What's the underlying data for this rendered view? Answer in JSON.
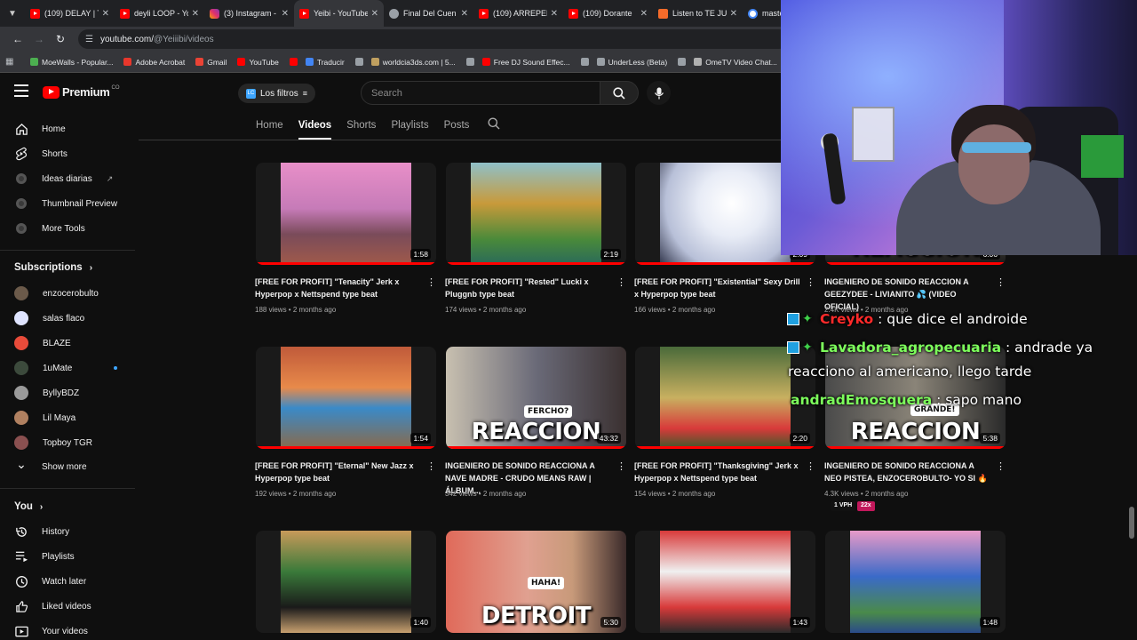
{
  "browser": {
    "tabs": [
      {
        "title": "(109) DELAY | T",
        "icon": "youtube-icon",
        "active": false
      },
      {
        "title": "deyli LOOP - Yo",
        "icon": "youtube-icon",
        "active": false
      },
      {
        "title": "(3) Instagram -",
        "icon": "instagram-icon",
        "active": false
      },
      {
        "title": "Yeibi - YouTube",
        "icon": "youtube-icon",
        "active": true
      },
      {
        "title": "Final Del Cuen",
        "icon": "globe-icon",
        "active": false
      },
      {
        "title": "(109) ARREPEN",
        "icon": "youtube-icon",
        "active": false
      },
      {
        "title": "(109) Dorante",
        "icon": "youtube-icon",
        "active": false
      },
      {
        "title": "Listen to TE JU",
        "icon": "web-icon",
        "active": false
      },
      {
        "title": "master",
        "icon": "google-icon",
        "active": false
      }
    ],
    "url_host": "youtube.com/",
    "url_path": "@Yeiiibi/videos",
    "bookmarks": [
      {
        "label": "MoeWalls - Popular...",
        "color": "#4caf50"
      },
      {
        "label": "Adobe Acrobat",
        "color": "#e8372c"
      },
      {
        "label": "Gmail",
        "color": "#ea4335"
      },
      {
        "label": "YouTube",
        "color": "#ff0000"
      },
      {
        "label": "",
        "color": "#ff0000"
      },
      {
        "label": "Traducir",
        "color": "#4285f4"
      },
      {
        "label": "",
        "color": "#9aa0a6"
      },
      {
        "label": "worldcia3ds.com | 5...",
        "color": "#c0a060"
      },
      {
        "label": "",
        "color": "#9aa0a6"
      },
      {
        "label": "Free DJ Sound Effec...",
        "color": "#ff0000"
      },
      {
        "label": "",
        "color": "#9aa0a6"
      },
      {
        "label": "UnderLess (Beta)",
        "color": "#9aa0a6"
      },
      {
        "label": "",
        "color": "#9aa0a6"
      },
      {
        "label": "OmeTV Video Chat...",
        "color": "#b0b0b0"
      }
    ]
  },
  "youtube": {
    "logo_word": "Premium",
    "logo_region": "CO",
    "filters_label": "Los filtros",
    "search_placeholder": "Search",
    "sidebar": {
      "main": [
        {
          "label": "Home",
          "icon": "home-icon"
        },
        {
          "label": "Shorts",
          "icon": "shorts-icon"
        },
        {
          "label": "Ideas diarias",
          "icon": "extension-icon",
          "external": true
        },
        {
          "label": "Thumbnail Preview",
          "icon": "extension-icon"
        },
        {
          "label": "More Tools",
          "icon": "extension-icon"
        }
      ],
      "subscriptions_heading": "Subscriptions",
      "subscriptions": [
        {
          "label": "enzocerobulto",
          "avatar": "#6b5a4a"
        },
        {
          "label": "salas flaco",
          "avatar": "#dfe4ff"
        },
        {
          "label": "BLAZE",
          "avatar": "#e84b3a"
        },
        {
          "label": "1uMate",
          "avatar": "#3c4a3c",
          "live": true
        },
        {
          "label": "ByllyBDZ",
          "avatar": "#9a9a9a"
        },
        {
          "label": "Lil Maya",
          "avatar": "#b08060"
        },
        {
          "label": "Topboy TGR",
          "avatar": "#8a5050"
        }
      ],
      "show_more": "Show more",
      "you_heading": "You",
      "you_items": [
        {
          "label": "History",
          "icon": "history-icon"
        },
        {
          "label": "Playlists",
          "icon": "playlists-icon"
        },
        {
          "label": "Watch later",
          "icon": "watch-later-icon"
        },
        {
          "label": "Liked videos",
          "icon": "like-icon"
        },
        {
          "label": "Your videos",
          "icon": "your-videos-icon"
        }
      ]
    },
    "channel_tabs": [
      {
        "label": "Home",
        "active": false
      },
      {
        "label": "Videos",
        "active": true
      },
      {
        "label": "Shorts",
        "active": false
      },
      {
        "label": "Playlists",
        "active": false
      },
      {
        "label": "Posts",
        "active": false
      }
    ],
    "videos": [
      {
        "title": "[FREE FOR PROFIT] \"Tenacity\" Jerk x Hyperpop x Nettspend type beat",
        "meta": "188 views • 2 months ago",
        "duration": "1:58",
        "art": "zelda"
      },
      {
        "title": "[FREE FOR PROFIT] \"Rested\" Lucki x Pluggnb type beat",
        "meta": "174 views • 2 months ago",
        "duration": "2:19",
        "art": "scooby"
      },
      {
        "title": "[FREE FOR PROFIT] \"Existential\" Sexy Drill x Hyperpop type beat",
        "meta": "166 views • 2 months ago",
        "duration": "2:09",
        "art": "white"
      },
      {
        "title": "INGENIERO DE SONIDO REACCION A GEEZYDEE - LIVIANITO 💦 (VIDEO OFICIAL)",
        "meta": "2.4K views • 2 months ago",
        "duration": "6:06",
        "art": "react1",
        "word": "REACCION"
      },
      {
        "title": "[FREE FOR PROFIT] \"Eternal\" New Jazz x Hyperpop type beat",
        "meta": "192 views • 2 months ago",
        "duration": "1:54",
        "art": "goku"
      },
      {
        "title": "INGENIERO DE SONIDO REACCIONA A NAVE MADRE - CRUDO MEANS RAW | ÁLBUM...",
        "meta": "342 views • 2 months ago",
        "duration": "43:32",
        "art": "nave",
        "word": "REACCION",
        "caption": "FERCHO?"
      },
      {
        "title": "[FREE FOR PROFIT] \"Thanksgiving\" Jerk x Hyperpop x Nettspend type beat",
        "meta": "154 views • 2 months ago",
        "duration": "2:20",
        "art": "link"
      },
      {
        "title": "INGENIERO DE SONIDO REACCIONA A NEO PISTEA, ENZOCEROBULTO- YO SI 🔥",
        "meta": "4.3K views • 2 months ago",
        "duration": "5:38",
        "art": "react2",
        "word": "REACCION",
        "caption": "GRANDE!",
        "badges": [
          "1 VPH",
          "22x"
        ]
      },
      {
        "title": "",
        "meta": "",
        "duration": "1:40",
        "art": "luigi"
      },
      {
        "title": "",
        "meta": "",
        "duration": "5:30",
        "art": "detroit",
        "word": "DETROIT",
        "caption": "HAHA!"
      },
      {
        "title": "",
        "meta": "",
        "duration": "1:43",
        "art": "robot"
      },
      {
        "title": "",
        "meta": "",
        "duration": "1:48",
        "art": "sonic"
      }
    ]
  },
  "chat": [
    {
      "user": "Creyko",
      "message": " : que dice el androide",
      "color": "#ff2a2a",
      "badges": true
    },
    {
      "user": "Lavadora_agropecuaria",
      "message": " : andrade ya",
      "color": "#7dff5c",
      "badges": true
    },
    {
      "user": "",
      "message": "reacciono al americano, llego tarde",
      "color": "#ffffff",
      "badges": false
    },
    {
      "user": "andradEmosquera",
      "message": " : sapo mano",
      "color": "#7dff5c",
      "badges": false
    }
  ]
}
